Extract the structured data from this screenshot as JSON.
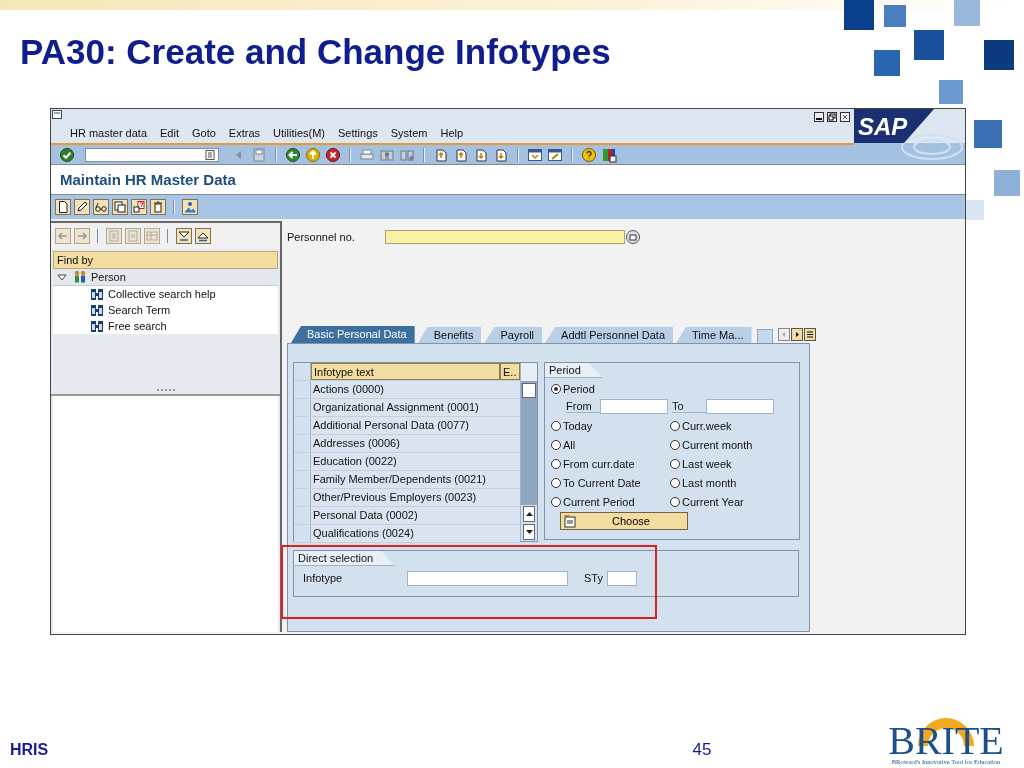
{
  "slide": {
    "title": "PA30: Create and Change Infotypes",
    "footer_label": "HRIS",
    "page_number": "45",
    "logo": {
      "name": "BRITE",
      "tagline": "BRoward's Innovative Tool for Education"
    }
  },
  "window": {
    "logo_text": "SAP",
    "menu": [
      "HR master data",
      "Edit",
      "Goto",
      "Extras",
      "Utilities(M)",
      "Settings",
      "System",
      "Help"
    ],
    "screen_title": "Maintain HR Master Data"
  },
  "nav_panel": {
    "header": "Find by",
    "tree": [
      {
        "label": "Person",
        "expanded": true,
        "children": [
          {
            "label": "Collective search help"
          },
          {
            "label": "Search Term"
          },
          {
            "label": "Free search"
          }
        ]
      }
    ]
  },
  "personnel_no": {
    "label": "Personnel no."
  },
  "tabs": [
    {
      "label": "Basic Personal Data",
      "selected": true
    },
    {
      "label": "Benefits",
      "selected": false
    },
    {
      "label": "Payroll",
      "selected": false
    },
    {
      "label": "Addtl Personnel Data",
      "selected": false
    },
    {
      "label": "Time Ma...",
      "selected": false
    }
  ],
  "infotype_list": {
    "columns": [
      "Infotype text",
      "E.."
    ],
    "rows": [
      "Actions (0000)",
      "Organizational Assignment (0001)",
      "Additional Personal Data (0077)",
      "Addresses (0006)",
      "Education (0022)",
      "Family Member/Dependents (0021)",
      "Other/Previous Employers (0023)",
      "Personal Data (0002)",
      "Qualifications (0024)"
    ]
  },
  "period": {
    "title": "Period",
    "from_label": "From",
    "to_label": "To",
    "choose_button": "Choose",
    "options": [
      {
        "label": "Period",
        "selected": true
      },
      {
        "label": "Today",
        "selected": false
      },
      {
        "label": "Curr.week",
        "selected": false
      },
      {
        "label": "All",
        "selected": false
      },
      {
        "label": "Current month",
        "selected": false
      },
      {
        "label": "From curr.date",
        "selected": false
      },
      {
        "label": "Last week",
        "selected": false
      },
      {
        "label": "To Current Date",
        "selected": false
      },
      {
        "label": "Last month",
        "selected": false
      },
      {
        "label": "Current Period",
        "selected": false
      },
      {
        "label": "Current Year",
        "selected": false
      }
    ]
  },
  "direct_selection": {
    "title": "Direct selection",
    "infotype_label": "Infotype",
    "subtype_label": "STy"
  }
}
